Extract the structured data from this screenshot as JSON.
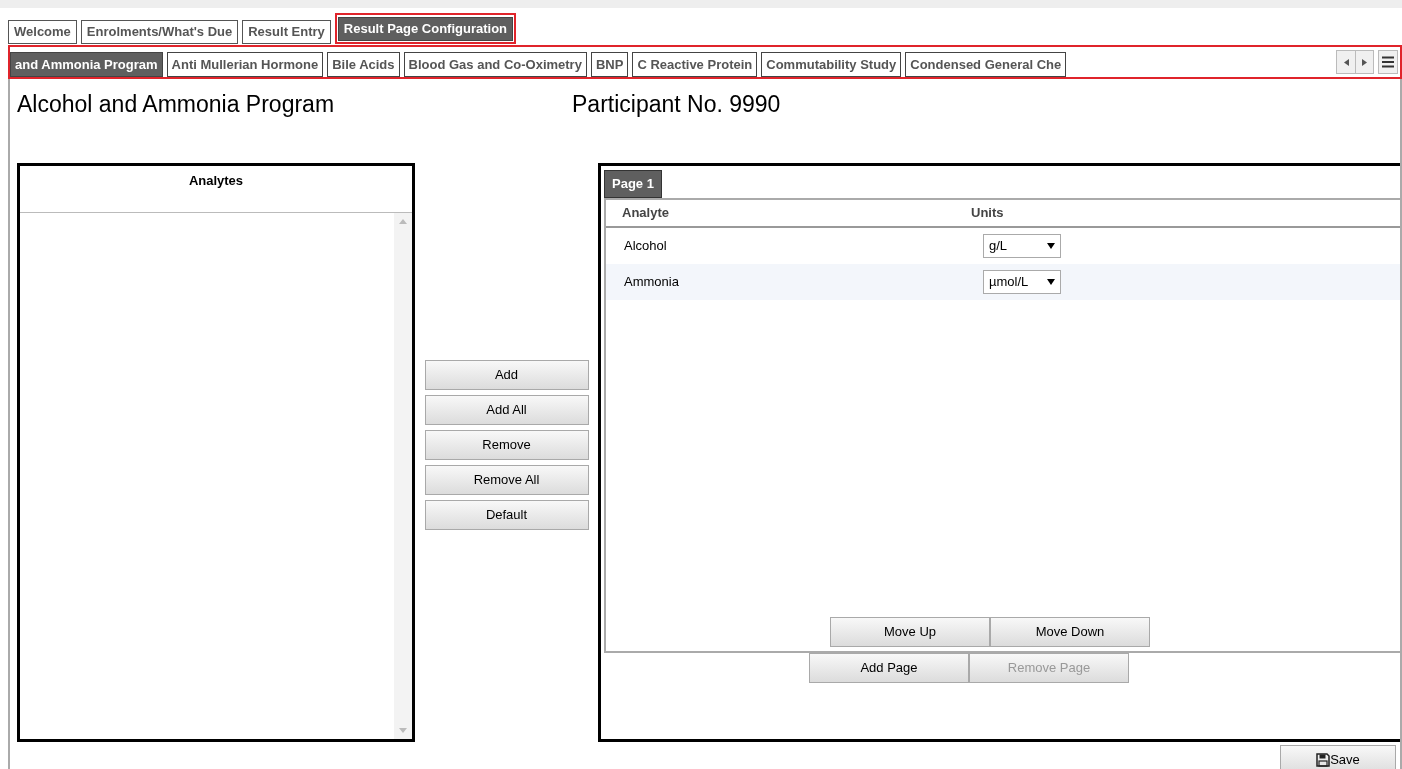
{
  "main_tabs": [
    {
      "label": "Welcome",
      "selected": false
    },
    {
      "label": "Enrolments/What's Due",
      "selected": false
    },
    {
      "label": "Result Entry",
      "selected": false
    },
    {
      "label": "Result Page Configuration",
      "selected": true
    }
  ],
  "program_tabs": [
    {
      "label": "and Ammonia Program",
      "selected": true
    },
    {
      "label": "Anti Mullerian Hormone",
      "selected": false
    },
    {
      "label": "Bile Acids",
      "selected": false
    },
    {
      "label": "Blood Gas and Co-Oximetry",
      "selected": false
    },
    {
      "label": "BNP",
      "selected": false
    },
    {
      "label": "C Reactive Protein",
      "selected": false
    },
    {
      "label": "Commutability Study",
      "selected": false
    },
    {
      "label": "Condensed General Che",
      "selected": false
    }
  ],
  "program_title": "Alcohol and Ammonia Program",
  "participant": "Participant No. 9990",
  "analytes_panel": {
    "title": "Analytes"
  },
  "transfer_buttons": [
    {
      "label": "Add",
      "disabled": false
    },
    {
      "label": "Add All",
      "disabled": false
    },
    {
      "label": "Remove",
      "disabled": false
    },
    {
      "label": "Remove All",
      "disabled": false
    },
    {
      "label": "Default",
      "disabled": false
    }
  ],
  "page_tabs": [
    {
      "label": "Page 1",
      "selected": true
    }
  ],
  "table": {
    "columns": [
      "Analyte",
      "Units"
    ],
    "rows": [
      {
        "analyte": "Alcohol",
        "units": "g/L"
      },
      {
        "analyte": "Ammonia",
        "units": "µmol/L"
      }
    ]
  },
  "move_buttons": [
    {
      "label": "Move Up",
      "disabled": false
    },
    {
      "label": "Move Down",
      "disabled": false
    }
  ],
  "page_buttons": [
    {
      "label": "Add Page",
      "disabled": false
    },
    {
      "label": "Remove Page",
      "disabled": true
    }
  ],
  "save_button": "Save"
}
